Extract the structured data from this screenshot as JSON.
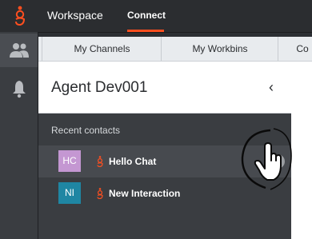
{
  "header": {
    "app_name": "Workspace",
    "nav_connect": "Connect",
    "accent_color": "#ff4f1f"
  },
  "siderail": {
    "items": [
      {
        "icon": "contacts-icon"
      },
      {
        "icon": "bell-icon"
      }
    ]
  },
  "tabs": [
    {
      "label": "My Channels"
    },
    {
      "label": "My Workbins"
    },
    {
      "label": "Co"
    }
  ],
  "agent_panel": {
    "name": "Agent Dev001",
    "collapse_glyph": "‹"
  },
  "recent_contacts": {
    "title": "Recent contacts",
    "items": [
      {
        "initials": "HC",
        "label": "Hello Chat",
        "avatar_color": "#c497d2",
        "channel_icon": "genesys-channel-icon"
      },
      {
        "initials": "NI",
        "label": "New Interaction",
        "avatar_color": "#1f86a3",
        "channel_icon": "genesys-channel-icon"
      }
    ],
    "close_glyph": "✕"
  }
}
